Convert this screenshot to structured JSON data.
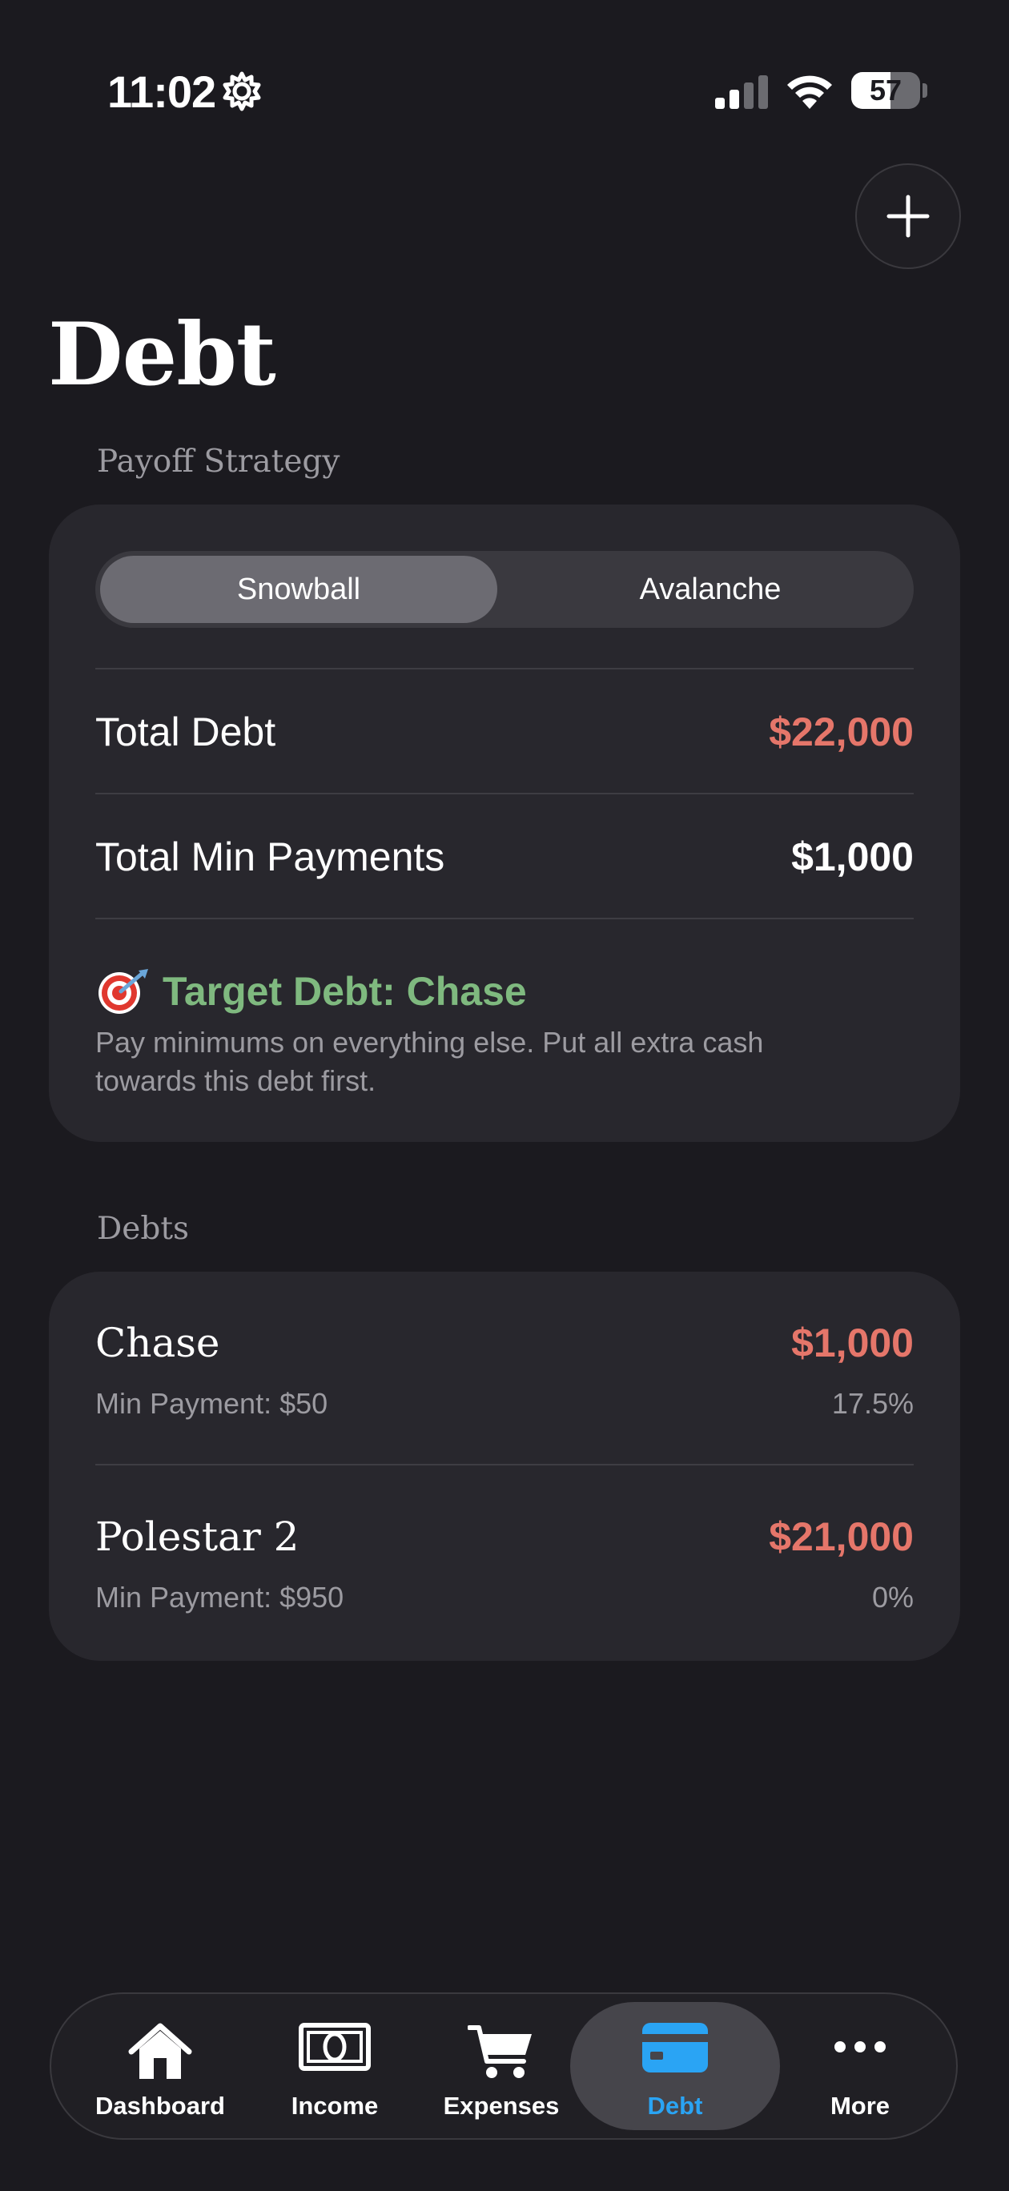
{
  "status_bar": {
    "time": "11:02",
    "battery": "57",
    "battery_level": 0.57
  },
  "header": {
    "title": "Debt",
    "add_icon": "plus-icon"
  },
  "strategy": {
    "section_label": "Payoff Strategy",
    "options": [
      "Snowball",
      "Avalanche"
    ],
    "selected": "Snowball",
    "total_debt_label": "Total Debt",
    "total_debt_value": "$22,000",
    "total_min_label": "Total Min Payments",
    "total_min_value": "$1,000",
    "target_title": "Target Debt: Chase",
    "target_description": "Pay minimums on everything else. Put all extra cash towards this debt first."
  },
  "debts": {
    "section_label": "Debts",
    "items": [
      {
        "name": "Chase",
        "amount": "$1,000",
        "min_payment": "Min Payment: $50",
        "rate": "17.5%"
      },
      {
        "name": "Polestar 2",
        "amount": "$21,000",
        "min_payment": "Min Payment: $950",
        "rate": "0%"
      }
    ]
  },
  "tab_bar": {
    "active": "Debt",
    "tabs": [
      {
        "label": "Dashboard",
        "icon": "house-icon"
      },
      {
        "label": "Income",
        "icon": "banknote-icon"
      },
      {
        "label": "Expenses",
        "icon": "cart-icon"
      },
      {
        "label": "Debt",
        "icon": "credit-card-icon"
      },
      {
        "label": "More",
        "icon": "ellipsis-icon"
      }
    ]
  },
  "colors": {
    "background": "#1b1a1f",
    "card": "#28272d",
    "negative_amount": "#e5766a",
    "target_green": "#7fb97f",
    "active_tab": "#2aa4f4"
  }
}
